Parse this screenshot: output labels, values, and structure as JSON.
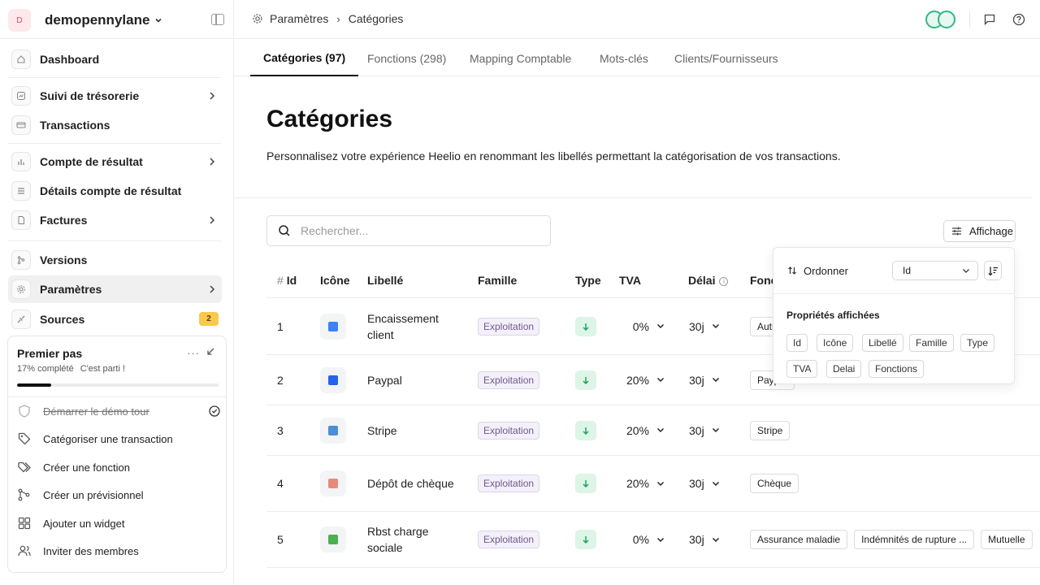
{
  "org": {
    "avatar": "D",
    "name": "demopennylane"
  },
  "sidebar": {
    "items": [
      {
        "label": "Dashboard"
      },
      {
        "label": "Suivi de trésorerie"
      },
      {
        "label": "Transactions"
      },
      {
        "label": "Compte de résultat"
      },
      {
        "label": "Détails compte de résultat"
      },
      {
        "label": "Factures"
      },
      {
        "label": "Versions"
      },
      {
        "label": "Paramètres"
      },
      {
        "label": "Sources",
        "badge": "2"
      }
    ]
  },
  "onboarding": {
    "title": "Premier pas",
    "more": "···",
    "progress_text": "17% complété",
    "progress_cta": "C'est parti !",
    "progress": 0.17,
    "tasks": [
      {
        "label": "Démarrer le démo tour",
        "done": true
      },
      {
        "label": "Catégoriser une transaction"
      },
      {
        "label": "Créer une fonction"
      },
      {
        "label": "Créer un prévisionnel"
      },
      {
        "label": "Ajouter un widget"
      },
      {
        "label": "Inviter des membres"
      }
    ]
  },
  "breadcrumb": {
    "parent": "Paramètres",
    "current": "Catégories"
  },
  "tabs": [
    {
      "label": "Catégories (97)",
      "active": true
    },
    {
      "label": "Fonctions (298)"
    },
    {
      "label": "Mapping Comptable"
    },
    {
      "label": "Mots-clés"
    },
    {
      "label": "Clients/Fournisseurs"
    }
  ],
  "page": {
    "title": "Catégories",
    "subtitle": "Personnalisez votre expérience Heelio en renommant les libellés permettant la catégorisation de vos transactions."
  },
  "search": {
    "placeholder": "Rechercher..."
  },
  "display_button": "Affichage",
  "table": {
    "headers": {
      "hash": "#",
      "id": "Id",
      "icon": "Icône",
      "label": "Libellé",
      "family": "Famille",
      "type": "Type",
      "tva": "TVA",
      "delai": "Délai",
      "fonctions": "Fonctions"
    },
    "rows": [
      {
        "id": "1",
        "icon_color": "#3b82f6",
        "label": "Encaissement client",
        "family": "Exploitation",
        "tva": "0%",
        "delai": "30j",
        "fonctions": [
          "Autre"
        ]
      },
      {
        "id": "2",
        "icon_color": "#2563eb",
        "label": "Paypal",
        "family": "Exploitation",
        "tva": "20%",
        "delai": "30j",
        "fonctions": [
          "Paypal"
        ]
      },
      {
        "id": "3",
        "icon_color": "#4b8fd6",
        "label": "Stripe",
        "family": "Exploitation",
        "tva": "20%",
        "delai": "30j",
        "fonctions": [
          "Stripe"
        ]
      },
      {
        "id": "4",
        "icon_color": "#e88a7a",
        "label": "Dépôt de chèque",
        "family": "Exploitation",
        "tva": "20%",
        "delai": "30j",
        "fonctions": [
          "Chèque"
        ]
      },
      {
        "id": "5",
        "icon_color": "#4caf50",
        "label": "Rbst charge sociale",
        "family": "Exploitation",
        "tva": "0%",
        "delai": "30j",
        "fonctions": [
          "Assurance maladie",
          "Indémnités de rupture ...",
          "Mutuelle"
        ]
      }
    ]
  },
  "popover": {
    "order_label": "Ordonner",
    "order_value": "Id",
    "props_title": "Propriétés affichées",
    "props": [
      "Id",
      "Icône",
      "Libellé",
      "Famille",
      "Type",
      "TVA",
      "Delai",
      "Fonctions"
    ]
  }
}
